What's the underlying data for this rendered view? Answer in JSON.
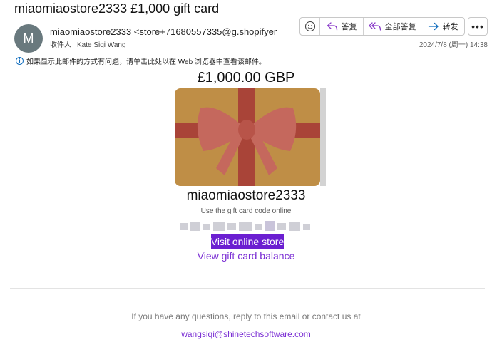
{
  "email": {
    "subject": "miaomiaostore2333 £1,000 gift card",
    "avatar_initial": "M",
    "sender": "miaomiaostore2333 <store+71680557335@g.shopifyer",
    "to_label": "收件人",
    "to_name": "Kate Siqi Wang",
    "date": "2024/7/8 (周一) 14:38",
    "info_text": "如果显示此邮件的方式有问题，请单击此处以在 Web 浏览器中查看该邮件。"
  },
  "toolbar": {
    "emoji_icon": "smiley-icon",
    "reply_label": "答复",
    "reply_all_label": "全部答复",
    "forward_label": "转发",
    "more_icon": "more-icon"
  },
  "gift_card": {
    "amount": "£1,000.00 GBP",
    "store_name": "miaomiaostore2333",
    "code_label": "Use the gift card code online",
    "visit_label": "Visit online store",
    "balance_label": "View gift card balance"
  },
  "footer": {
    "text": "If you have any questions, reply to this email or contact us at",
    "email": "wangsiqi@shinetechsoftware.com"
  },
  "colors": {
    "card_gold": "#bf8e46",
    "ribbon": "#a94438",
    "bow": "#c5685d",
    "accent_purple": "#6b1fd1"
  }
}
